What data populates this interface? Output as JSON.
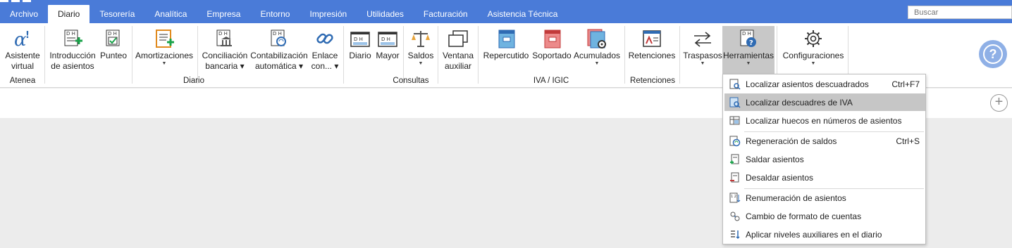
{
  "tabs": [
    "Archivo",
    "Diario",
    "Tesorería",
    "Analítica",
    "Empresa",
    "Entorno",
    "Impresión",
    "Utilidades",
    "Facturación",
    "Asistencia Técnica"
  ],
  "active_tab": "Diario",
  "search": {
    "placeholder": "Buscar"
  },
  "ribbon": {
    "asistente": {
      "line1": "Asistente",
      "line2": "virtual"
    },
    "introduccion": {
      "line1": "Introducción",
      "line2": "de asientos"
    },
    "punteo": {
      "line1": "Punteo"
    },
    "amortizaciones": {
      "line1": "Amortizaciones"
    },
    "conciliacion": {
      "line1": "Conciliación",
      "line2": "bancaria"
    },
    "contabilizacion": {
      "line1": "Contabilización",
      "line2": "automática"
    },
    "enlace": {
      "line1": "Enlace",
      "line2": "con..."
    },
    "diario": {
      "line1": "Diario"
    },
    "mayor": {
      "line1": "Mayor"
    },
    "saldos": {
      "line1": "Saldos"
    },
    "ventana": {
      "line1": "Ventana",
      "line2": "auxiliar"
    },
    "repercutido": {
      "line1": "Repercutido"
    },
    "soportado": {
      "line1": "Soportado"
    },
    "acumulados": {
      "line1": "Acumulados"
    },
    "retenciones": {
      "line1": "Retenciones"
    },
    "traspasos": {
      "line1": "Traspasos"
    },
    "herramientas": {
      "line1": "Herramientas"
    },
    "configuraciones": {
      "line1": "Configuraciones"
    }
  },
  "groups": {
    "atenea": "Atenea",
    "diario": "Diario",
    "consultas": "Consultas",
    "iva": "IVA / IGIC",
    "retenciones": "Retenciones"
  },
  "menu": {
    "items": [
      {
        "label": "Localizar asientos descuadrados",
        "shortcut": "Ctrl+F7",
        "icon": "find-unbalanced-icon"
      },
      {
        "label": "Localizar descuadres de IVA",
        "shortcut": "",
        "icon": "find-vat-icon",
        "highlighted": true
      },
      {
        "label": "Localizar huecos en números de asientos",
        "shortcut": "",
        "icon": "find-gaps-icon"
      },
      {
        "label": "Regeneración de saldos",
        "shortcut": "Ctrl+S",
        "icon": "regenerate-balances-icon"
      },
      {
        "label": "Saldar asientos",
        "shortcut": "",
        "icon": "settle-entries-icon"
      },
      {
        "label": "Desaldar asientos",
        "shortcut": "",
        "icon": "unsettle-entries-icon"
      },
      {
        "label": "Renumeración de asientos",
        "shortcut": "",
        "icon": "renumber-icon"
      },
      {
        "label": "Cambio de formato de cuentas",
        "shortcut": "",
        "icon": "account-format-icon"
      },
      {
        "label": "Aplicar niveles auxiliares en el diario",
        "shortcut": "",
        "icon": "aux-levels-icon"
      }
    ]
  },
  "colors": {
    "topbar": "#4a7bd8",
    "highlight": "#c6c6c6",
    "accent_green": "#1aa34a",
    "help": "#8fb0e6"
  }
}
